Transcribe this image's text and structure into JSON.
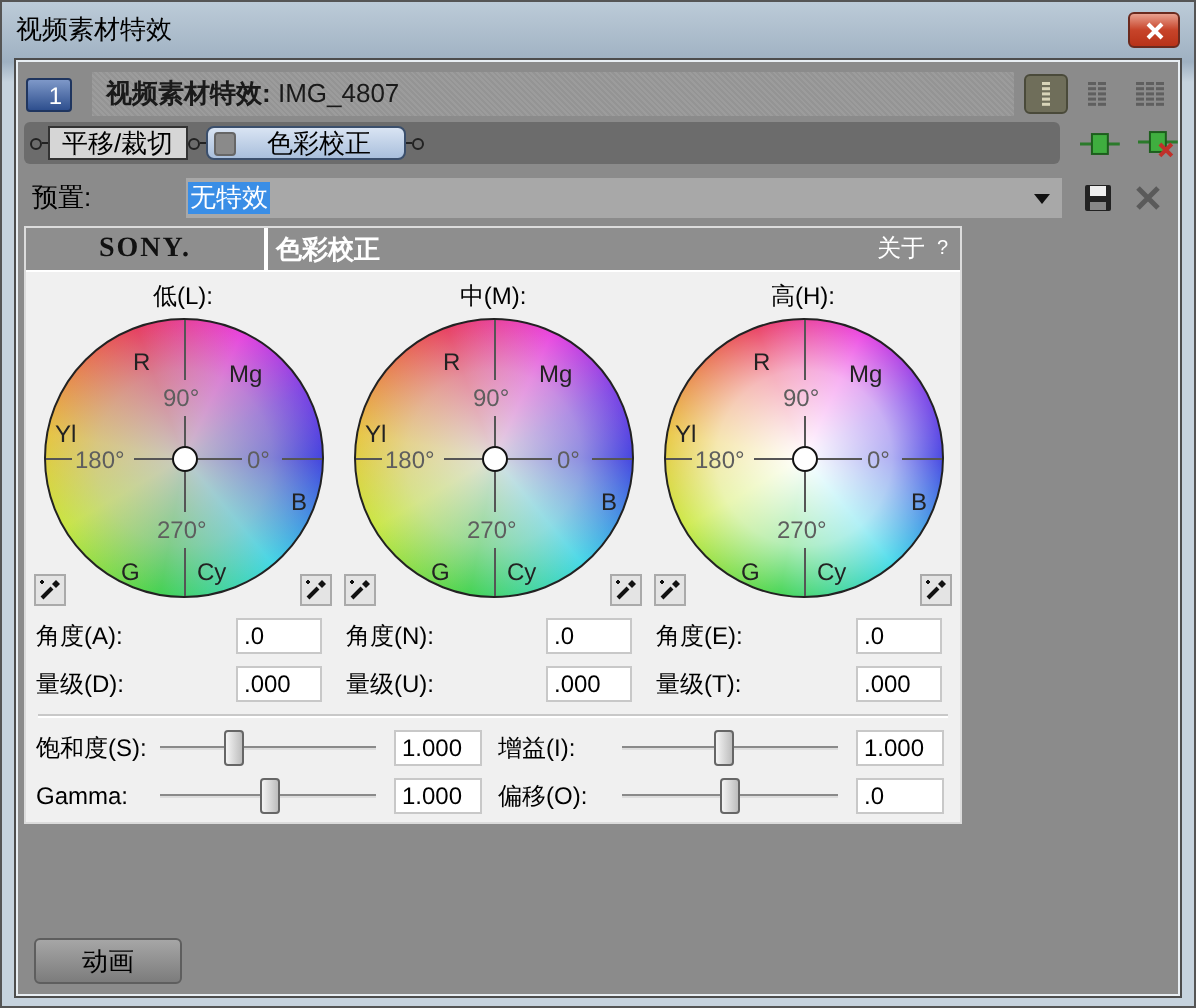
{
  "window": {
    "title": "视频素材特效"
  },
  "track": {
    "number": "1"
  },
  "header": {
    "label": "视频素材特效:",
    "clip": "IMG_4807"
  },
  "view_buttons": [
    {
      "selected": true
    },
    {
      "selected": false
    },
    {
      "selected": false
    }
  ],
  "fx_chain": [
    {
      "label": "平移/裁切",
      "selected": false
    },
    {
      "label": "色彩校正",
      "selected": true
    }
  ],
  "preset": {
    "label": "预置:",
    "value": "无特效"
  },
  "plugin": {
    "brand": "SONY.",
    "title": "色彩校正",
    "about": "关于",
    "help": "?"
  },
  "wheels": [
    {
      "label": "低(L):",
      "hue_labels": [
        "R",
        "Mg",
        "Yl",
        "B",
        "G",
        "Cy"
      ],
      "angle_labels": [
        "90°",
        "180°",
        "0°",
        "270°"
      ],
      "fields": [
        {
          "label": "角度(A):",
          "value": ".0"
        },
        {
          "label": "量级(D):",
          "value": ".000"
        }
      ]
    },
    {
      "label": "中(M):",
      "hue_labels": [
        "R",
        "Mg",
        "Yl",
        "B",
        "G",
        "Cy"
      ],
      "angle_labels": [
        "90°",
        "180°",
        "0°",
        "270°"
      ],
      "fields": [
        {
          "label": "角度(N):",
          "value": ".0"
        },
        {
          "label": "量级(U):",
          "value": ".000"
        }
      ]
    },
    {
      "label": "高(H):",
      "hue_labels": [
        "R",
        "Mg",
        "Yl",
        "B",
        "G",
        "Cy"
      ],
      "angle_labels": [
        "90°",
        "180°",
        "0°",
        "270°"
      ],
      "fields": [
        {
          "label": "角度(E):",
          "value": ".0"
        },
        {
          "label": "量级(T):",
          "value": ".000"
        }
      ]
    }
  ],
  "sliders": [
    {
      "label": "饱和度(S):",
      "level": 0.34,
      "value": "1.000"
    },
    {
      "label": "增益(I):",
      "level": 0.47,
      "value": "1.000"
    },
    {
      "label": "Gamma:",
      "level": 0.51,
      "value": "1.000"
    },
    {
      "label": "偏移(O):",
      "level": 0.5,
      "value": ".0"
    }
  ],
  "animate_button": "动画"
}
